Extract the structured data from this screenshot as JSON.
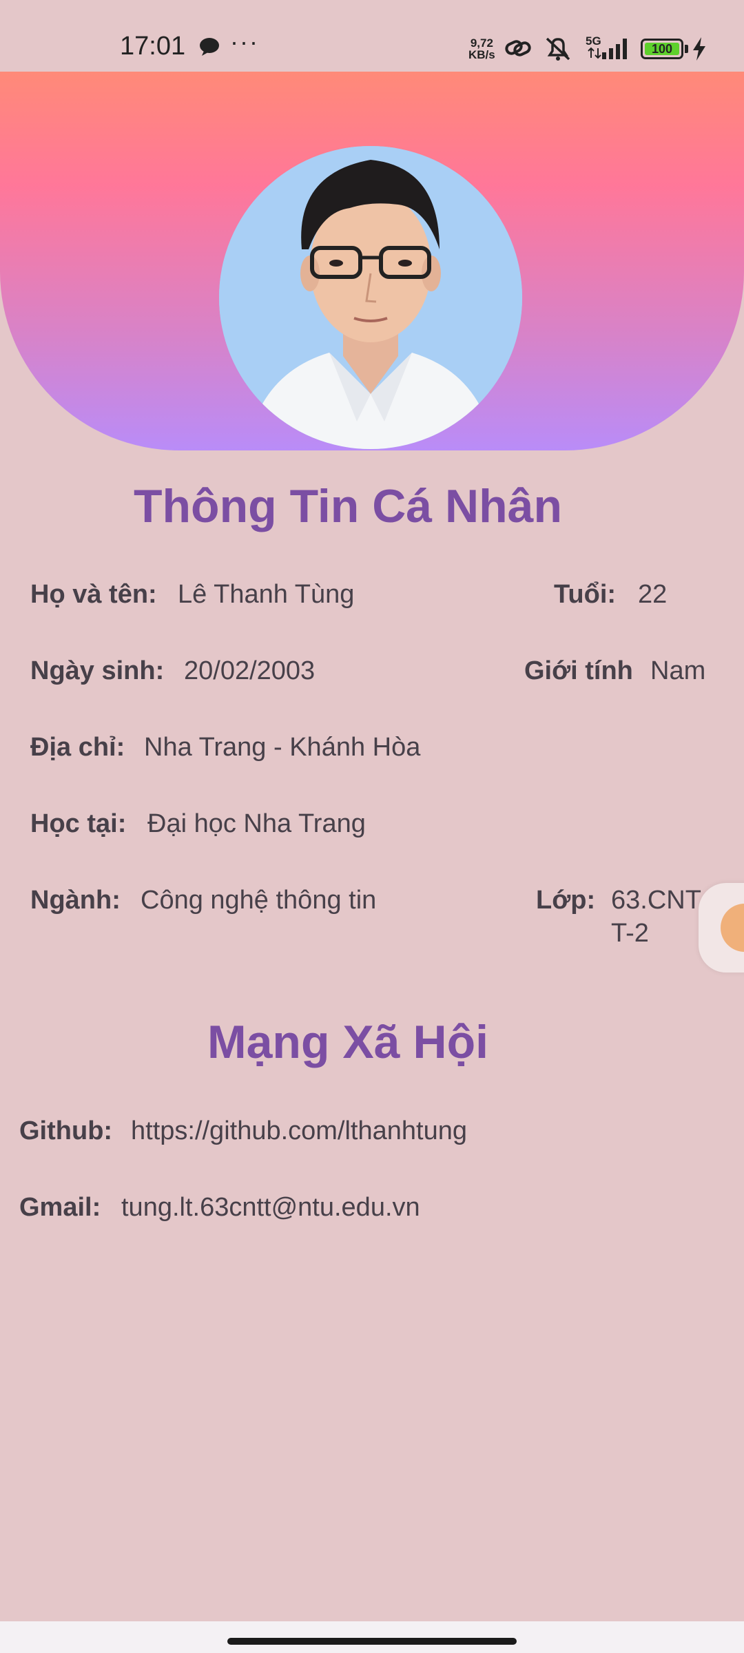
{
  "status_bar": {
    "time": "17:01",
    "dots": "···",
    "speed_value": "9,72",
    "speed_unit": "KB/s",
    "network": "5G",
    "battery": "100"
  },
  "profile": {
    "title": "Thông Tin Cá Nhân",
    "name_label": "Họ và tên:",
    "name_value": "Lê Thanh Tùng",
    "age_label": "Tuổi:",
    "age_value": "22",
    "dob_label": "Ngày sinh:",
    "dob_value": "20/02/2003",
    "gender_label": "Giới tính",
    "gender_value": "Nam",
    "address_label": "Địa chỉ:",
    "address_value": "Nha Trang - Khánh Hòa",
    "school_label": "Học tại:",
    "school_value": "Đại học Nha Trang",
    "major_label": "Ngành:",
    "major_value": "Công nghệ thông tin",
    "class_label": "Lớp:",
    "class_value_line1": "63.CNT",
    "class_value_line2": "T-2"
  },
  "social": {
    "title": "Mạng Xã Hội",
    "github_label": "Github:",
    "github_value": "https://github.com/lthanhtung",
    "gmail_label": "Gmail:",
    "gmail_value": "tung.lt.63cntt@ntu.edu.vn"
  }
}
